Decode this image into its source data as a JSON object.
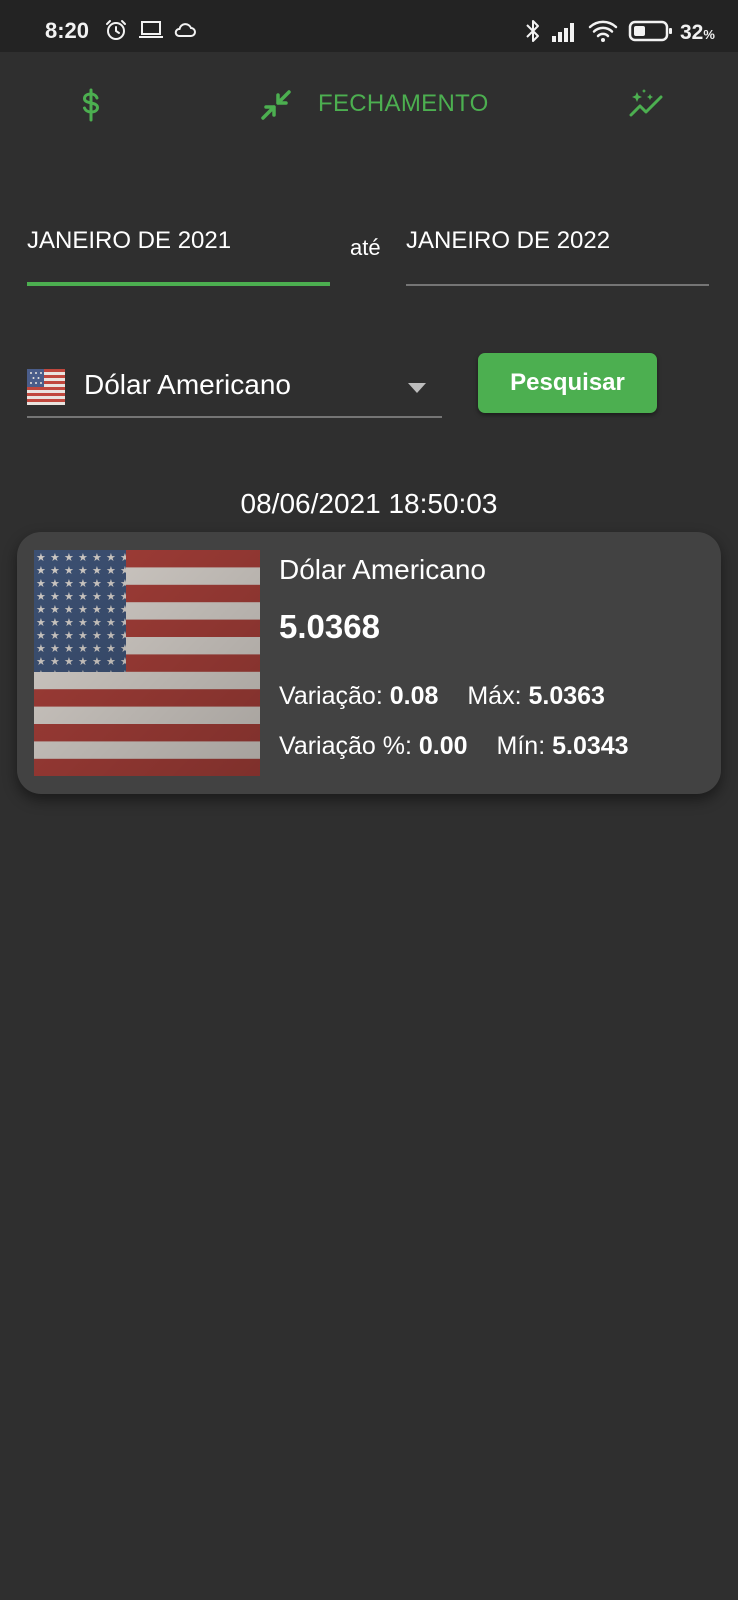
{
  "status_bar": {
    "time": "8:20",
    "battery_percent": "32",
    "battery_unit": "%",
    "icons": [
      "alarm-icon",
      "laptop-icon",
      "cloud-icon",
      "bluetooth-icon",
      "signal-icon",
      "wifi-icon",
      "battery-icon"
    ]
  },
  "top_nav": {
    "label": "FECHAMENTO",
    "icons": [
      "dollar-icon",
      "compress-arrows-icon",
      "sparkle-chart-icon"
    ],
    "accent_color": "#4caf50"
  },
  "date_range": {
    "start": "JANEIRO DE 2021",
    "separator": "até",
    "end": "JANEIRO DE 2022"
  },
  "currency_select": {
    "selected": "Dólar Americano",
    "flag": "us-flag-icon"
  },
  "search_button": {
    "label": "Pesquisar"
  },
  "result": {
    "timestamp": "08/06/2021 18:50:03",
    "card": {
      "name": "Dólar Americano",
      "rate": "5.0368",
      "variation_label": "Variação:",
      "variation_value": "0.08",
      "max_label": "Máx:",
      "max_value": "5.0363",
      "variation_pct_label": "Variação %:",
      "variation_pct_value": "0.00",
      "min_label": "Mín:",
      "min_value": "5.0343"
    }
  },
  "colors": {
    "background": "#2f2f2f",
    "card": "#424242",
    "accent": "#4caf50"
  }
}
